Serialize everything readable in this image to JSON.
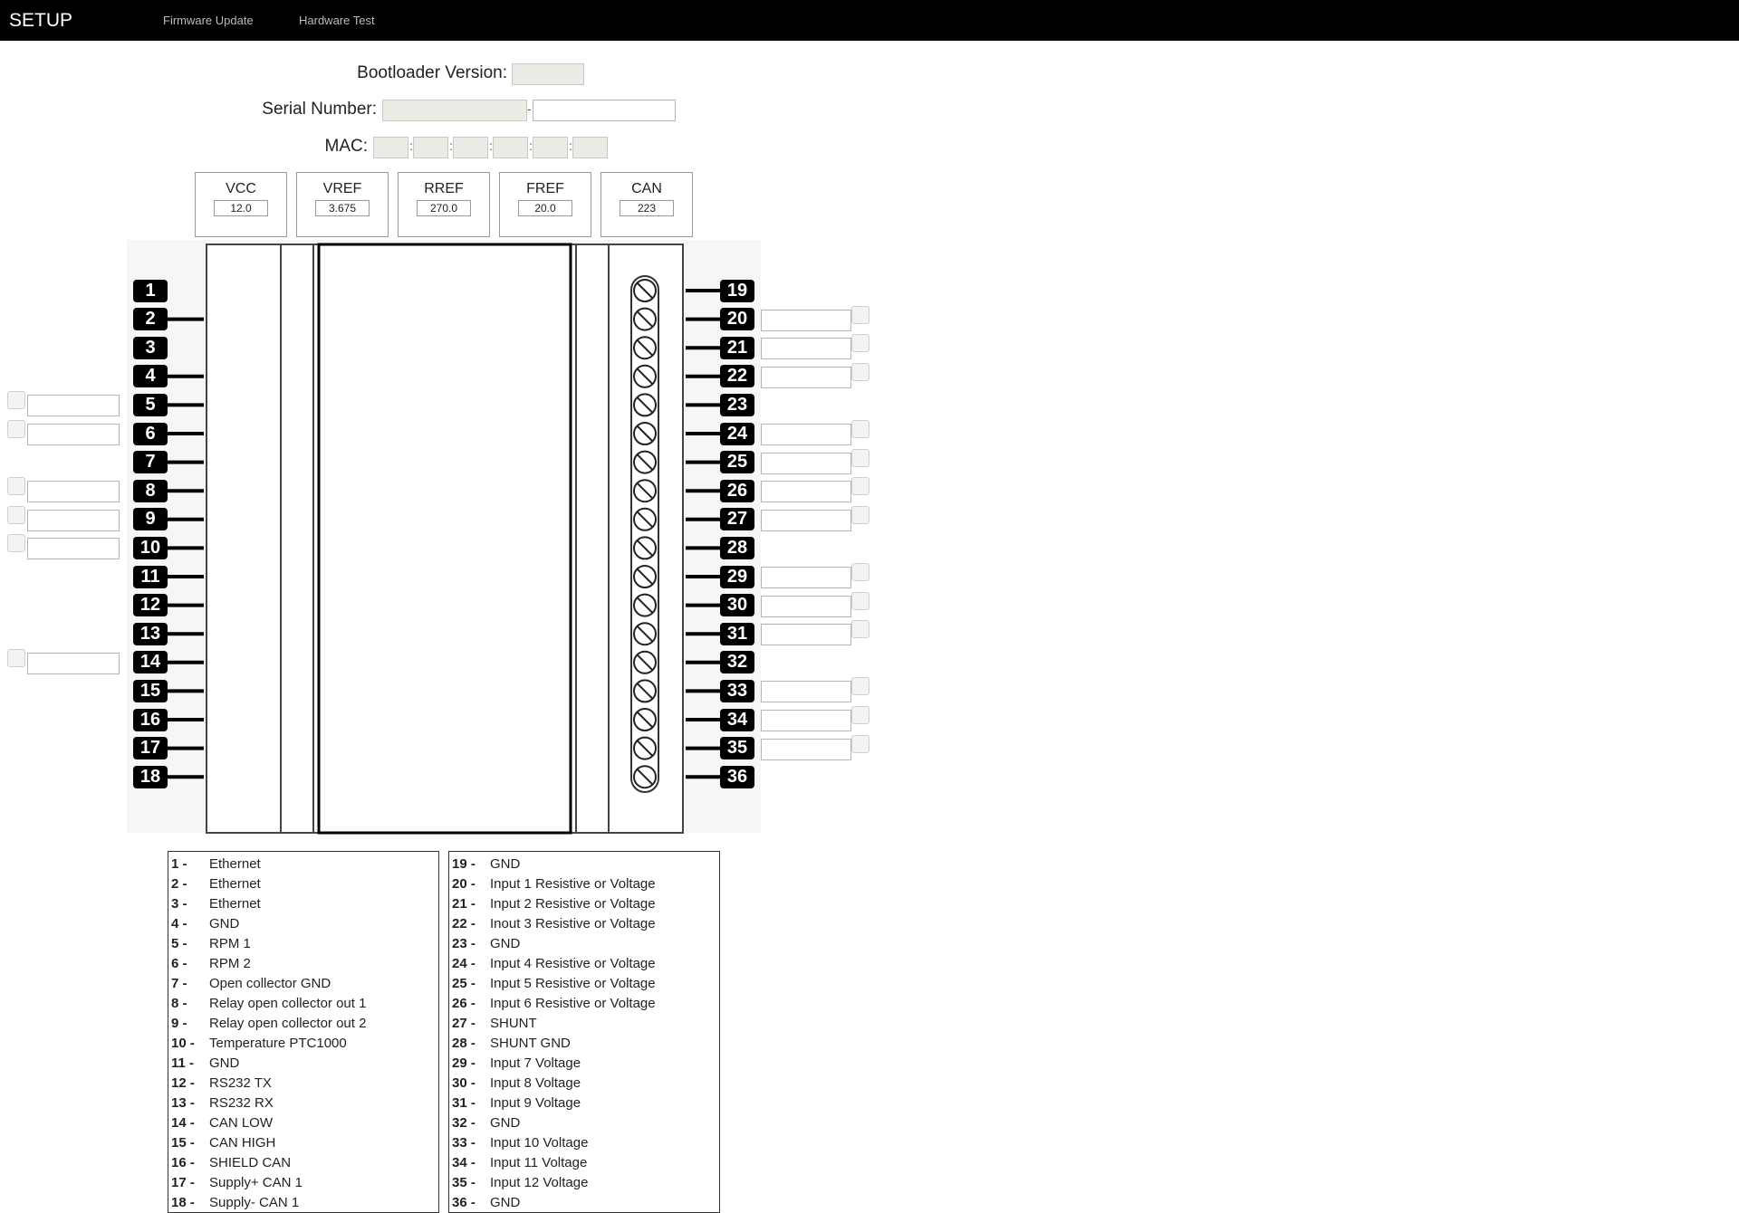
{
  "nav": {
    "brand": "SETUP",
    "links": [
      "Firmware Update",
      "Hardware Test"
    ]
  },
  "device": {
    "bootloader_label": "Bootloader Version:",
    "serial_label": "Serial Number:",
    "serial_separator": "-",
    "mac_label": "MAC:",
    "mac_separator": ":"
  },
  "refs": [
    {
      "label": "VCC",
      "value": "12.0"
    },
    {
      "label": "VREF",
      "value": "3.675"
    },
    {
      "label": "RREF",
      "value": "270.0"
    },
    {
      "label": "FREF",
      "value": "20.0"
    },
    {
      "label": "CAN",
      "value": "223"
    }
  ],
  "left_pins": [
    {
      "num": "1",
      "field": false
    },
    {
      "num": "2",
      "field": false
    },
    {
      "num": "3",
      "field": false
    },
    {
      "num": "4",
      "field": false
    },
    {
      "num": "5",
      "field": true
    },
    {
      "num": "6",
      "field": true
    },
    {
      "num": "7",
      "field": false
    },
    {
      "num": "8",
      "field": true
    },
    {
      "num": "9",
      "field": true
    },
    {
      "num": "10",
      "field": true
    },
    {
      "num": "11",
      "field": false
    },
    {
      "num": "12",
      "field": false
    },
    {
      "num": "13",
      "field": false
    },
    {
      "num": "14",
      "field": true
    },
    {
      "num": "15",
      "field": false
    },
    {
      "num": "16",
      "field": false
    },
    {
      "num": "17",
      "field": false
    },
    {
      "num": "18",
      "field": false
    }
  ],
  "right_pins": [
    {
      "num": "19",
      "field": false
    },
    {
      "num": "20",
      "field": true
    },
    {
      "num": "21",
      "field": true
    },
    {
      "num": "22",
      "field": true
    },
    {
      "num": "23",
      "field": false
    },
    {
      "num": "24",
      "field": true
    },
    {
      "num": "25",
      "field": true
    },
    {
      "num": "26",
      "field": true
    },
    {
      "num": "27",
      "field": true
    },
    {
      "num": "28",
      "field": false
    },
    {
      "num": "29",
      "field": true
    },
    {
      "num": "30",
      "field": true
    },
    {
      "num": "31",
      "field": true
    },
    {
      "num": "32",
      "field": false
    },
    {
      "num": "33",
      "field": true
    },
    {
      "num": "34",
      "field": true
    },
    {
      "num": "35",
      "field": true
    },
    {
      "num": "36",
      "field": false
    }
  ],
  "legend_left": [
    {
      "num": "1 -",
      "desc": "Ethernet"
    },
    {
      "num": "2 -",
      "desc": "Ethernet"
    },
    {
      "num": "3 -",
      "desc": "Ethernet"
    },
    {
      "num": "4 -",
      "desc": "GND"
    },
    {
      "num": "5 -",
      "desc": "RPM 1"
    },
    {
      "num": "6 -",
      "desc": "RPM 2"
    },
    {
      "num": "7 -",
      "desc": "Open collector GND"
    },
    {
      "num": "8 -",
      "desc": "Relay open collector out 1"
    },
    {
      "num": "9 -",
      "desc": "Relay open collector out 2"
    },
    {
      "num": "10 -",
      "desc": "Temperature PTC1000"
    },
    {
      "num": "11 -",
      "desc": "GND"
    },
    {
      "num": "12 -",
      "desc": "RS232 TX"
    },
    {
      "num": "13 -",
      "desc": "RS232 RX"
    },
    {
      "num": "14 -",
      "desc": "CAN LOW"
    },
    {
      "num": "15 -",
      "desc": "CAN HIGH"
    },
    {
      "num": "16 -",
      "desc": "SHIELD CAN"
    },
    {
      "num": "17 -",
      "desc": "Supply+ CAN 1"
    },
    {
      "num": "18 -",
      "desc": "Supply- CAN 1"
    }
  ],
  "legend_right": [
    {
      "num": "19 -",
      "desc": "GND"
    },
    {
      "num": "20 -",
      "desc": "Input 1 Resistive or Voltage"
    },
    {
      "num": "21 -",
      "desc": "Input 2 Resistive or Voltage"
    },
    {
      "num": "22 -",
      "desc": "Inout 3 Resistive or Voltage"
    },
    {
      "num": "23 -",
      "desc": "GND"
    },
    {
      "num": "24 -",
      "desc": "Input 4 Resistive or Voltage"
    },
    {
      "num": "25 -",
      "desc": "Input 5 Resistive or Voltage"
    },
    {
      "num": "26 -",
      "desc": "Input 6 Resistive or Voltage"
    },
    {
      "num": "27 -",
      "desc": "SHUNT"
    },
    {
      "num": "28 -",
      "desc": "SHUNT GND"
    },
    {
      "num": "29 -",
      "desc": "Input 7 Voltage"
    },
    {
      "num": "30 -",
      "desc": "Input 8 Voltage"
    },
    {
      "num": "31 -",
      "desc": "Input 9 Voltage"
    },
    {
      "num": "32 -",
      "desc": "GND"
    },
    {
      "num": "33 -",
      "desc": "Input 10 Voltage"
    },
    {
      "num": "34 -",
      "desc": "Input 11 Voltage"
    },
    {
      "num": "35 -",
      "desc": "Input 12 Voltage"
    },
    {
      "num": "36 -",
      "desc": "GND"
    }
  ]
}
